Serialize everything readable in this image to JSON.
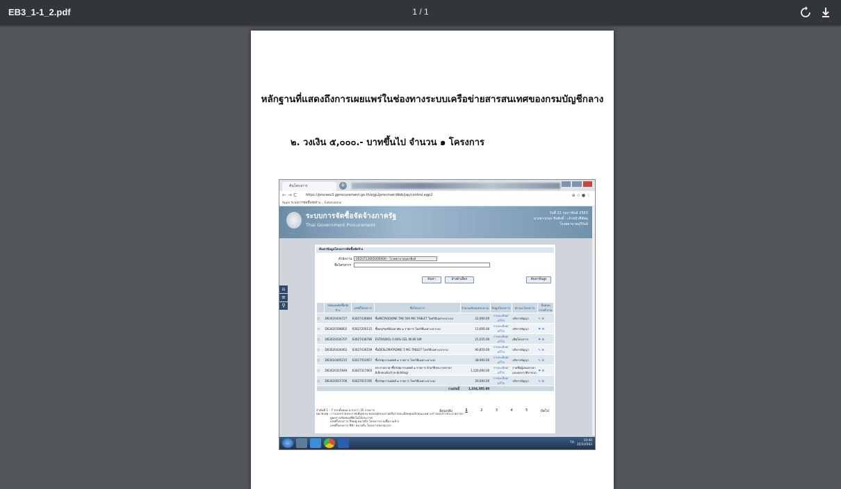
{
  "viewer": {
    "filename": "EB3_1-1_2.pdf",
    "page_indicator": "1 / 1",
    "icons": [
      "rotate-icon",
      "download-icon"
    ]
  },
  "document": {
    "heading": "หลักฐานที่แสดงถึงการเผยแพร่ในช่องทางระบบเครือข่ายสารสนเทศของกรมบัญชีกลาง",
    "subheading": "๒. วงเงิน ๕,๐๐๐.- บาทขึ้นไป จำนวน ๑ โครงการ"
  },
  "screenshot": {
    "browser": {
      "tab_label": "ค้นโครงการ",
      "url": "https://process3.gprocurement.go.th/egp2procmainWeb/jsp/control.egp2",
      "bookmarks": "Apps   ระบบการจัดซื้อจัดจ้าง...   Extensions"
    },
    "banner": {
      "title": "ระบบการจัดซื้อจัดจ้างภาครัฐ",
      "subtitle": "Thai Government Procurement",
      "date_line": "วันที่ 21 กุมภาพันธ์ 2563",
      "user_line": "นางสาวกนก จิรศักดิ์ : เจ้าหน้าที่พัสดุ",
      "org_line": "โรงพยาบาลบุรีรัมย์"
    },
    "form": {
      "panel_title": "ค้นหาข้อมูลโครงการจัดซื้อจัดจ้าง",
      "org_label": "สำนักงาน",
      "org_value": "0010713005000000 - โรงพยาบาลนครพิงค์",
      "project_label": "ชื่อโครงการ",
      "search_button": "ค้นหา",
      "clear_button": "ล้างตัวเลือก",
      "advanced_button": "ค้นหาขั้นสูง"
    },
    "table": {
      "headers": [
        "รหัสแผนจัดซื้อจัดจ้าง",
        "เลขที่โครงการ",
        "ชื่อโครงการ",
        "จำนวนเงินงบประมาณ",
        "ข้อมูลโครงการ",
        "สถานะโครงการ",
        "ขั้นตอนการทำงาน"
      ],
      "rows": [
        {
          "plan": "D63020434727",
          "proj": "63027436884",
          "name": "ซื้อMETADOXINE TAB 500 MG TABLET โดยวิธีเฉพาะเจาะจง",
          "amount": "22,000.00",
          "info": "รายละเอียด/แก้ไข",
          "status": "บริหารสัญญา"
        },
        {
          "plan": "D63020198802",
          "proj": "63027200115",
          "name": "ซื้อครุภัณฑ์ห้องผ่าตัด ๑ รายการ โดยวิธีเฉพาะเจาะจง",
          "amount": "11,600.00",
          "info": "รายละเอียด/แก้ไข",
          "status": "บริหารสัญญา"
        },
        {
          "plan": "D63020436707",
          "proj": "63027438786",
          "name": "ESTRADIOL 0.06% GEL IN 80 GM",
          "amount": "21,035.00",
          "info": "รายละเอียด/แก้ไข",
          "status": "เพิ่มโครงการ"
        },
        {
          "plan": "D63020434462",
          "proj": "63027436539",
          "name": "ซื้อDESLORATADINE 5 MG TABLET โดยวิธีเฉพาะเจาะจง",
          "amount": "90,850.00",
          "info": "รายละเอียด/แก้ไข",
          "status": "บริหารสัญญา"
        },
        {
          "plan": "D63010495215",
          "proj": "63017503957",
          "name": "ซื้อวัสดุการแพทย์ ๑ รายการ โดยวิธีเฉพาะเจาะจง",
          "amount": "38,900.00",
          "info": "รายละเอียด/แก้ไข",
          "status": "บริหารสัญญา"
        },
        {
          "plan": "D63020315949",
          "proj": "63027317903",
          "name": "ประกวดราคาซื้อวัสดุการแพทย์ ๑ รายการ ด้วยวิธีประกวดราคาอิเล็กทรอนิกส์ (e-bidding)",
          "amount": "1,120,000.00",
          "info": "รายละเอียด/แก้ไข",
          "status": "รายชื่อผู้เสนอราคาและผลการพิจารณา"
        },
        {
          "plan": "D63020015706",
          "proj": "63027015785",
          "name": "ซื้อวัสดุการแพทย์ ๑ รายการ โดยวิธีเฉพาะเจาะจง",
          "amount": "29,000.00",
          "info": "รายละเอียด/แก้ไข",
          "status": "บริหารสัญญา"
        }
      ],
      "total_label": "รวมเงินนี้",
      "total_value": "1,334,385.00"
    },
    "footer": {
      "summary": "ลำดับที่ 1 - 7 จากทั้งหมด มากกว่า 35 รายการ",
      "note1": "หมายเหตุ : การแจกจ่ายประกาศเชิญชวน ขอบเขตของงานหรือรายละเอียดคุณลักษณะเฉพาะ/ร่างเอกสารประกวดราคา",
      "note2": "ดูผลการเปิดซองที่ยังไม่ได้ประกาศ",
      "note3": "เลขที่โครงการ สีชมพู หมายถึง โครงการรวมซื้อรวมจ้าง",
      "note4": "เลขที่โครงการ สีฟ้า หมายถึง โครงการขยายเวลา",
      "prev": "ย้อนกลับ",
      "pages": [
        "1",
        "2",
        "3",
        "4",
        "5"
      ],
      "next": "ถัดไป"
    },
    "taskbar": {
      "lang": "TH",
      "time": "10:40",
      "date": "25/2/2563"
    }
  }
}
